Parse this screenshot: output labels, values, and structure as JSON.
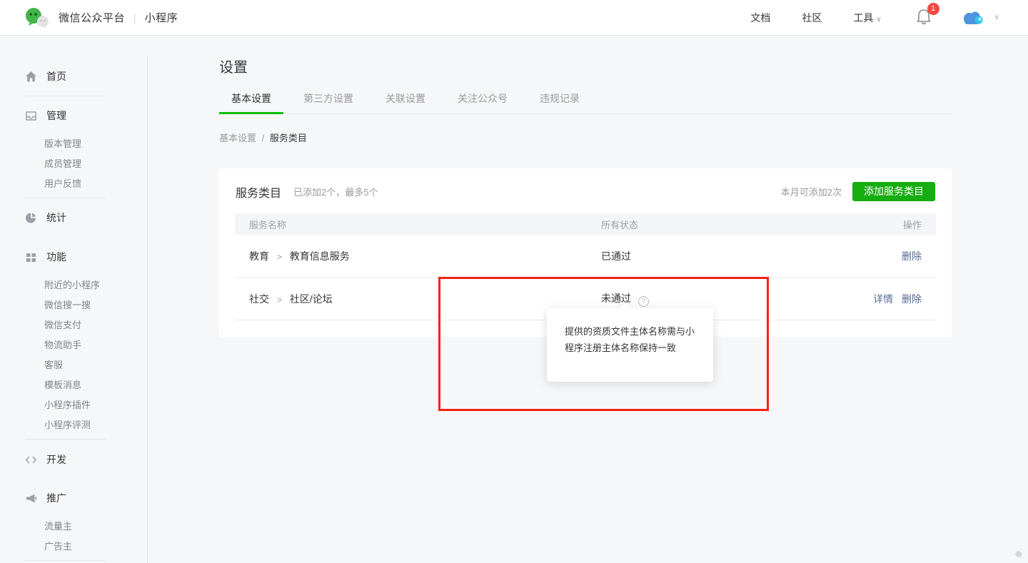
{
  "header": {
    "brand": "微信公众平台",
    "brand_separator": "|",
    "brand_sub": "小程序",
    "nav_docs": "文档",
    "nav_community": "社区",
    "nav_tools": "工具",
    "notification_count": "1"
  },
  "sidebar": {
    "home": {
      "label": "首页"
    },
    "manage": {
      "label": "管理",
      "sub": [
        "版本管理",
        "成员管理",
        "用户反馈"
      ]
    },
    "stats": {
      "label": "统计"
    },
    "features": {
      "label": "功能",
      "sub": [
        "附近的小程序",
        "微信搜一搜",
        "微信支付",
        "物流助手",
        "客服",
        "模板消息",
        "小程序插件",
        "小程序评测"
      ]
    },
    "dev": {
      "label": "开发"
    },
    "promote": {
      "label": "推广",
      "sub": [
        "流量主",
        "广告主"
      ]
    }
  },
  "main": {
    "title": "设置",
    "tabs": [
      {
        "label": "基本设置",
        "active": true
      },
      {
        "label": "第三方设置",
        "active": false
      },
      {
        "label": "关联设置",
        "active": false
      },
      {
        "label": "关注公众号",
        "active": false
      },
      {
        "label": "违规记录",
        "active": false
      }
    ],
    "breadcrumb": {
      "parent": "基本设置",
      "separator": "/",
      "current": "服务类目"
    },
    "card": {
      "title": "服务类目",
      "subtitle": "已添加2个，最多5个",
      "quota_hint": "本月可添加2次",
      "add_button": "添加服务类目",
      "table": {
        "headers": [
          "服务名称",
          "所有状态",
          "操作"
        ],
        "arrow": ">",
        "rows": [
          {
            "category": "教育",
            "subcategory": "教育信息服务",
            "status": "已通过",
            "action_delete": "删除"
          },
          {
            "category": "社交",
            "subcategory": "社区/论坛",
            "status": "未通过",
            "help": "?",
            "action_detail": "详情",
            "action_delete": "删除"
          }
        ]
      }
    },
    "tooltip": {
      "text": "提供的资质文件主体名称需与小程序注册主体名称保持一致"
    }
  },
  "colors": {
    "accent_green": "#16ad10",
    "tab_active_underline": "#0abf0a",
    "link_blue": "#576b95",
    "annotation_red": "#f32215",
    "badge_red": "#f5483f",
    "page_background": "#f6f7f9"
  }
}
